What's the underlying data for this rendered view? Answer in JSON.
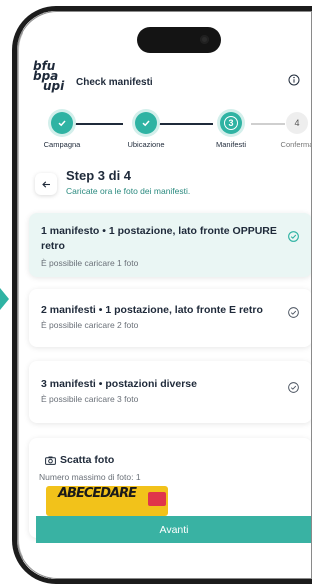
{
  "header": {
    "logo_lines": [
      "bfu",
      "bpa",
      "upi"
    ],
    "title": "Check manifesti",
    "info_icon": "info-icon"
  },
  "stepper": {
    "steps": [
      {
        "label": "Campagna",
        "state": "done"
      },
      {
        "label": "Ubicazione",
        "state": "done"
      },
      {
        "label": "Manifesti",
        "state": "active",
        "number": "3"
      },
      {
        "label": "Conferma",
        "state": "pending",
        "number": "4"
      }
    ]
  },
  "step_header": {
    "title": "Step 3 di 4",
    "subtitle": "Caricate ora le foto dei manifesti."
  },
  "options": [
    {
      "title": "1 manifesto • 1 postazione, lato fronte OPPURE retro",
      "desc": "È possibile caricare 1 foto",
      "selected": true
    },
    {
      "title": "2 manifesti • 1 postazione, lato fronte E retro",
      "desc": "È possibile caricare 2 foto",
      "selected": false
    },
    {
      "title": "3 manifesti • postazioni diverse",
      "desc": "È possibile caricare 3 foto",
      "selected": false
    }
  ],
  "photo": {
    "title": "Scatta foto",
    "desc": "Numero massimo di foto: 1",
    "thumb_text": "ABECEDARE"
  },
  "actions": {
    "primary_label": "Avanti"
  },
  "colors": {
    "accent": "#2fb3a3",
    "text": "#1f2a3a"
  }
}
